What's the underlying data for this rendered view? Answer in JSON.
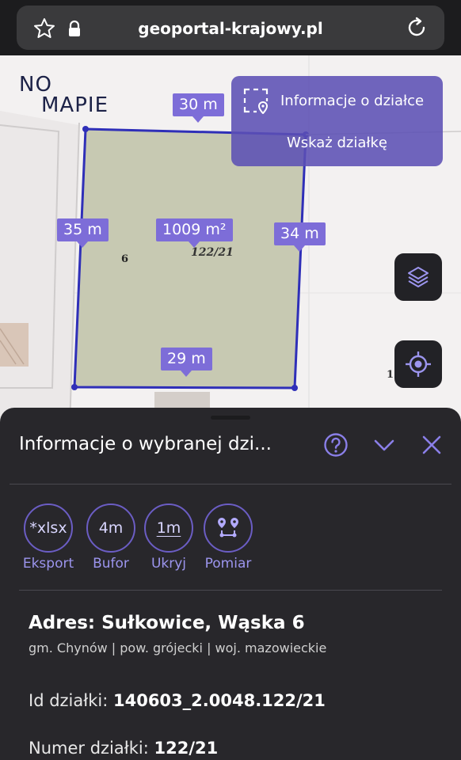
{
  "browser": {
    "url": "geoportal-krajowy.pl"
  },
  "logo": {
    "line1": "NO",
    "line2": "MAPIE"
  },
  "map": {
    "dimensions": {
      "top": "30 m",
      "left": "35 m",
      "right": "34 m",
      "bottom": "29 m",
      "area": "1009 m²"
    },
    "parcel_label": "122/21",
    "neighbor_label": "6",
    "edge_label": "1"
  },
  "info_panel": {
    "parcel_info_label": "Informacje o działce",
    "select_parcel_label": "Wskaż działkę"
  },
  "sheet": {
    "title": "Informacje o wybranej dzi...",
    "tools": [
      {
        "icon_text": "*xlsx",
        "label": "Eksport"
      },
      {
        "icon_text": "4m",
        "label": "Bufor"
      },
      {
        "icon_text": "1m",
        "label": "Ukryj"
      },
      {
        "icon_text": "",
        "label": "Pomiar"
      }
    ],
    "address": "Adres: Sułkowice, Wąska 6",
    "address_sub": "gm. Chynów | pow. grójecki | woj. mazowieckie",
    "id_label": "Id działki:",
    "id_value": "140603_2.0048.122/21",
    "number_label": "Numer działki:",
    "number_value": "122/21"
  },
  "colors": {
    "accent": "#7d6dd8",
    "parcel_fill": "#c7c9b2",
    "parcel_border": "#2f2fb8",
    "sheet_bg": "#28272b"
  }
}
